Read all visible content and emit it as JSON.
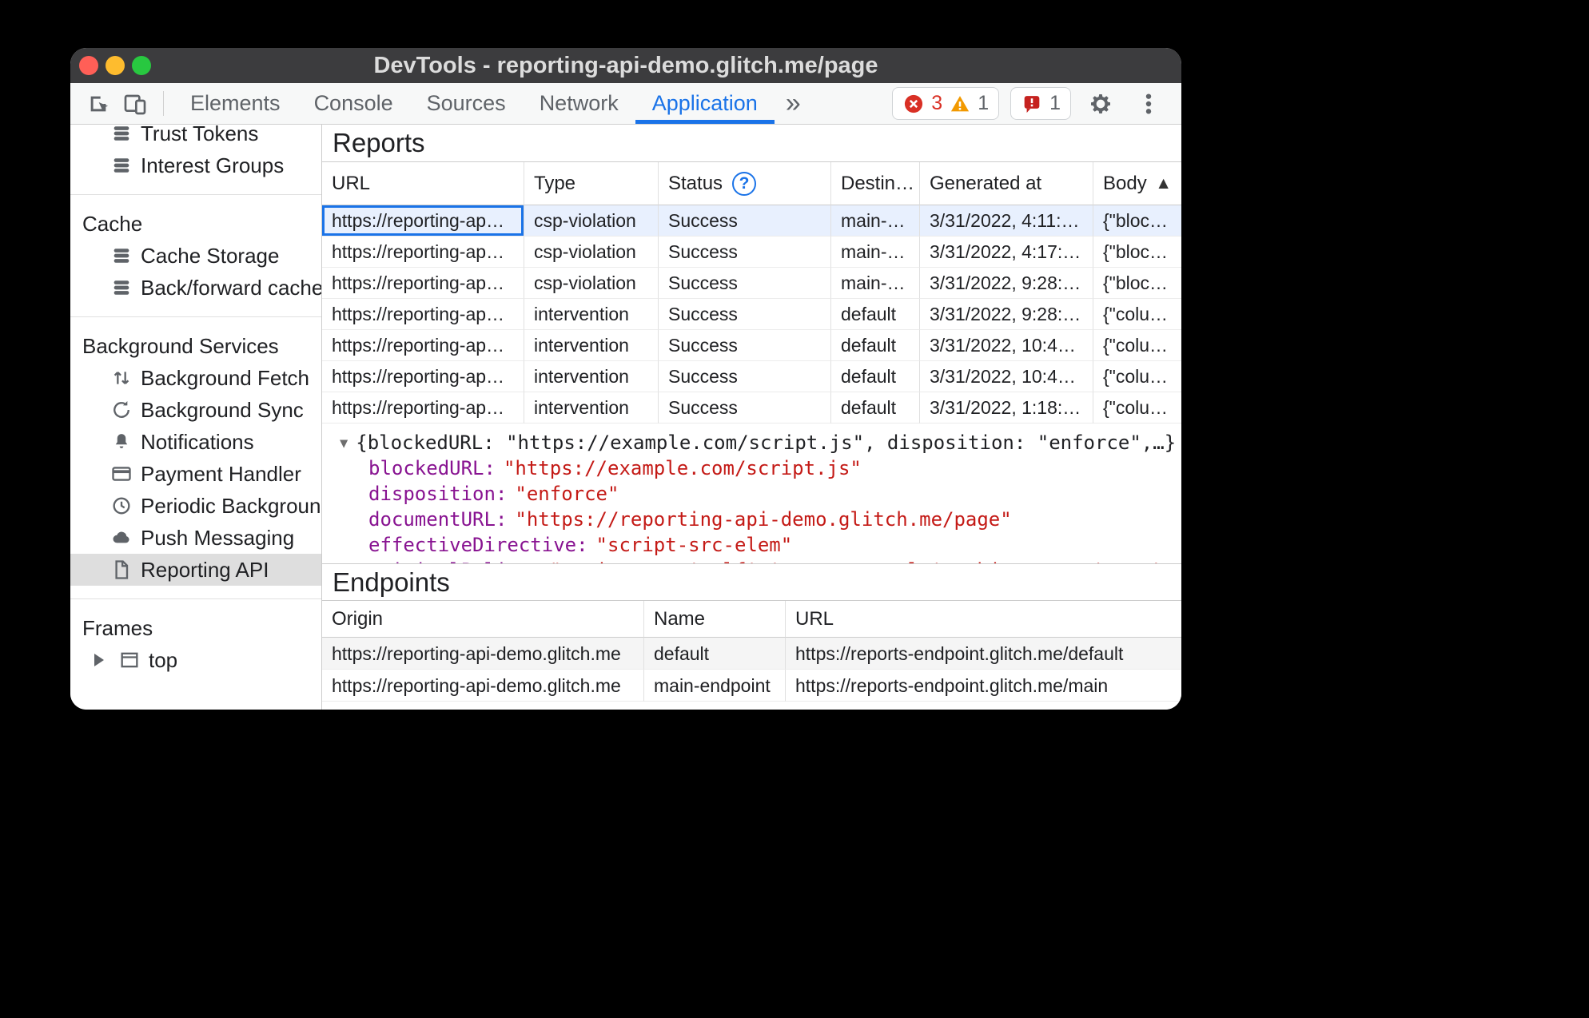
{
  "window": {
    "title": "DevTools - reporting-api-demo.glitch.me/page"
  },
  "colors": {
    "accent": "#1a73e8",
    "error": "#d93025",
    "warning": "#f29900",
    "titlebar": "#3c3c3e",
    "selected_row": "#e8f0fe",
    "selected_sidebar": "#dedede",
    "traffic_red": "#ff5f57",
    "traffic_yellow": "#febc2e",
    "traffic_green": "#28c840",
    "json_key": "#881391",
    "json_string": "#c41a16"
  },
  "glyphs": {
    "expanded": "▼",
    "more_tabs": "»",
    "sort_asc": "▲",
    "help": "?"
  },
  "toolbar": {
    "tabs": [
      "Elements",
      "Console",
      "Sources",
      "Network",
      "Application"
    ],
    "selected_tab": "Application",
    "error_count": "3",
    "warning_count": "1",
    "issue_count": "1"
  },
  "sidebar": {
    "groups": [
      {
        "items": [
          {
            "label": "Trust Tokens"
          },
          {
            "label": "Interest Groups"
          }
        ]
      },
      {
        "header": "Cache",
        "items": [
          {
            "label": "Cache Storage"
          },
          {
            "label": "Back/forward cache"
          }
        ]
      },
      {
        "header": "Background Services",
        "items": [
          {
            "label": "Background Fetch"
          },
          {
            "label": "Background Sync"
          },
          {
            "label": "Notifications"
          },
          {
            "label": "Payment Handler"
          },
          {
            "label": "Periodic Background"
          },
          {
            "label": "Push Messaging"
          },
          {
            "label": "Reporting API"
          }
        ]
      },
      {
        "header": "Frames",
        "items": [
          {
            "label": "top"
          }
        ]
      }
    ]
  },
  "reports": {
    "title": "Reports",
    "columns": {
      "url": "URL",
      "type": "Type",
      "status": "Status",
      "destination": "Destin…",
      "generated": "Generated at",
      "body": "Body"
    },
    "rows": [
      {
        "url": "https://reporting-ap…",
        "type": "csp-violation",
        "status": "Success",
        "destination": "main-…",
        "generated": "3/31/2022, 4:11:…",
        "body": "{\"bloc…"
      },
      {
        "url": "https://reporting-ap…",
        "type": "csp-violation",
        "status": "Success",
        "destination": "main-…",
        "generated": "3/31/2022, 4:17:…",
        "body": "{\"bloc…"
      },
      {
        "url": "https://reporting-ap…",
        "type": "csp-violation",
        "status": "Success",
        "destination": "main-…",
        "generated": "3/31/2022, 9:28:…",
        "body": "{\"bloc…"
      },
      {
        "url": "https://reporting-ap…",
        "type": "intervention",
        "status": "Success",
        "destination": "default",
        "generated": "3/31/2022, 9:28:…",
        "body": "{\"colu…"
      },
      {
        "url": "https://reporting-ap…",
        "type": "intervention",
        "status": "Success",
        "destination": "default",
        "generated": "3/31/2022, 10:4…",
        "body": "{\"colu…"
      },
      {
        "url": "https://reporting-ap…",
        "type": "intervention",
        "status": "Success",
        "destination": "default",
        "generated": "3/31/2022, 10:4…",
        "body": "{\"colu…"
      },
      {
        "url": "https://reporting-ap…",
        "type": "intervention",
        "status": "Success",
        "destination": "default",
        "generated": "3/31/2022, 1:18:…",
        "body": "{\"colu…"
      }
    ]
  },
  "report_detail": {
    "summary": "{blockedURL: \"https://example.com/script.js\", disposition: \"enforce\",…}",
    "properties": [
      {
        "key": "blockedURL:",
        "value": "\"https://example.com/script.js\""
      },
      {
        "key": "disposition:",
        "value": "\"enforce\""
      },
      {
        "key": "documentURL:",
        "value": "\"https://reporting-api-demo.glitch.me/page\""
      },
      {
        "key": "effectiveDirective:",
        "value": "\"script-src-elem\""
      },
      {
        "key": "originalPolicy:",
        "value": "\"script-src 'self' 'report-sample'; object-src 'none'; report-to main-endpoint;\""
      }
    ]
  },
  "endpoints": {
    "title": "Endpoints",
    "columns": {
      "origin": "Origin",
      "name": "Name",
      "url": "URL"
    },
    "rows": [
      {
        "origin": "https://reporting-api-demo.glitch.me",
        "name": "default",
        "url": "https://reports-endpoint.glitch.me/default"
      },
      {
        "origin": "https://reporting-api-demo.glitch.me",
        "name": "main-endpoint",
        "url": "https://reports-endpoint.glitch.me/main"
      }
    ]
  }
}
